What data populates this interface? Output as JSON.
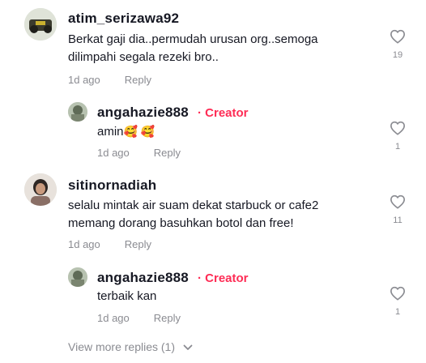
{
  "comments": [
    {
      "username": "atim_serizawa92",
      "text_line1": "Berkat gaji dia..permudah urusan org..semoga",
      "text_line2": "dilimpahi segala rezeki bro..",
      "time": "1d ago",
      "reply_label": "Reply",
      "likes": "19",
      "replies": [
        {
          "username": "angahazie888",
          "badge_sep": "·",
          "badge": "Creator",
          "text": "amin",
          "emoji": "🥰 🥰",
          "time": "1d ago",
          "reply_label": "Reply",
          "likes": "1"
        }
      ]
    },
    {
      "username": "sitinornadiah",
      "text_line1": "selalu mintak air suam dekat starbuck or cafe2",
      "text_line2": "memang dorang basuhkan botol dan free!",
      "time": "1d ago",
      "reply_label": "Reply",
      "likes": "11",
      "replies": [
        {
          "username": "angahazie888",
          "badge_sep": "·",
          "badge": "Creator",
          "text": "terbaik kan",
          "time": "1d ago",
          "reply_label": "Reply",
          "likes": "1"
        }
      ]
    }
  ],
  "view_more": "View more replies (1)",
  "icons": {
    "like": "heart-outline-icon",
    "expand": "chevron-down-icon"
  },
  "colors": {
    "creator": "#fe2c55",
    "meta": "#8a8b91",
    "text": "#161823"
  }
}
